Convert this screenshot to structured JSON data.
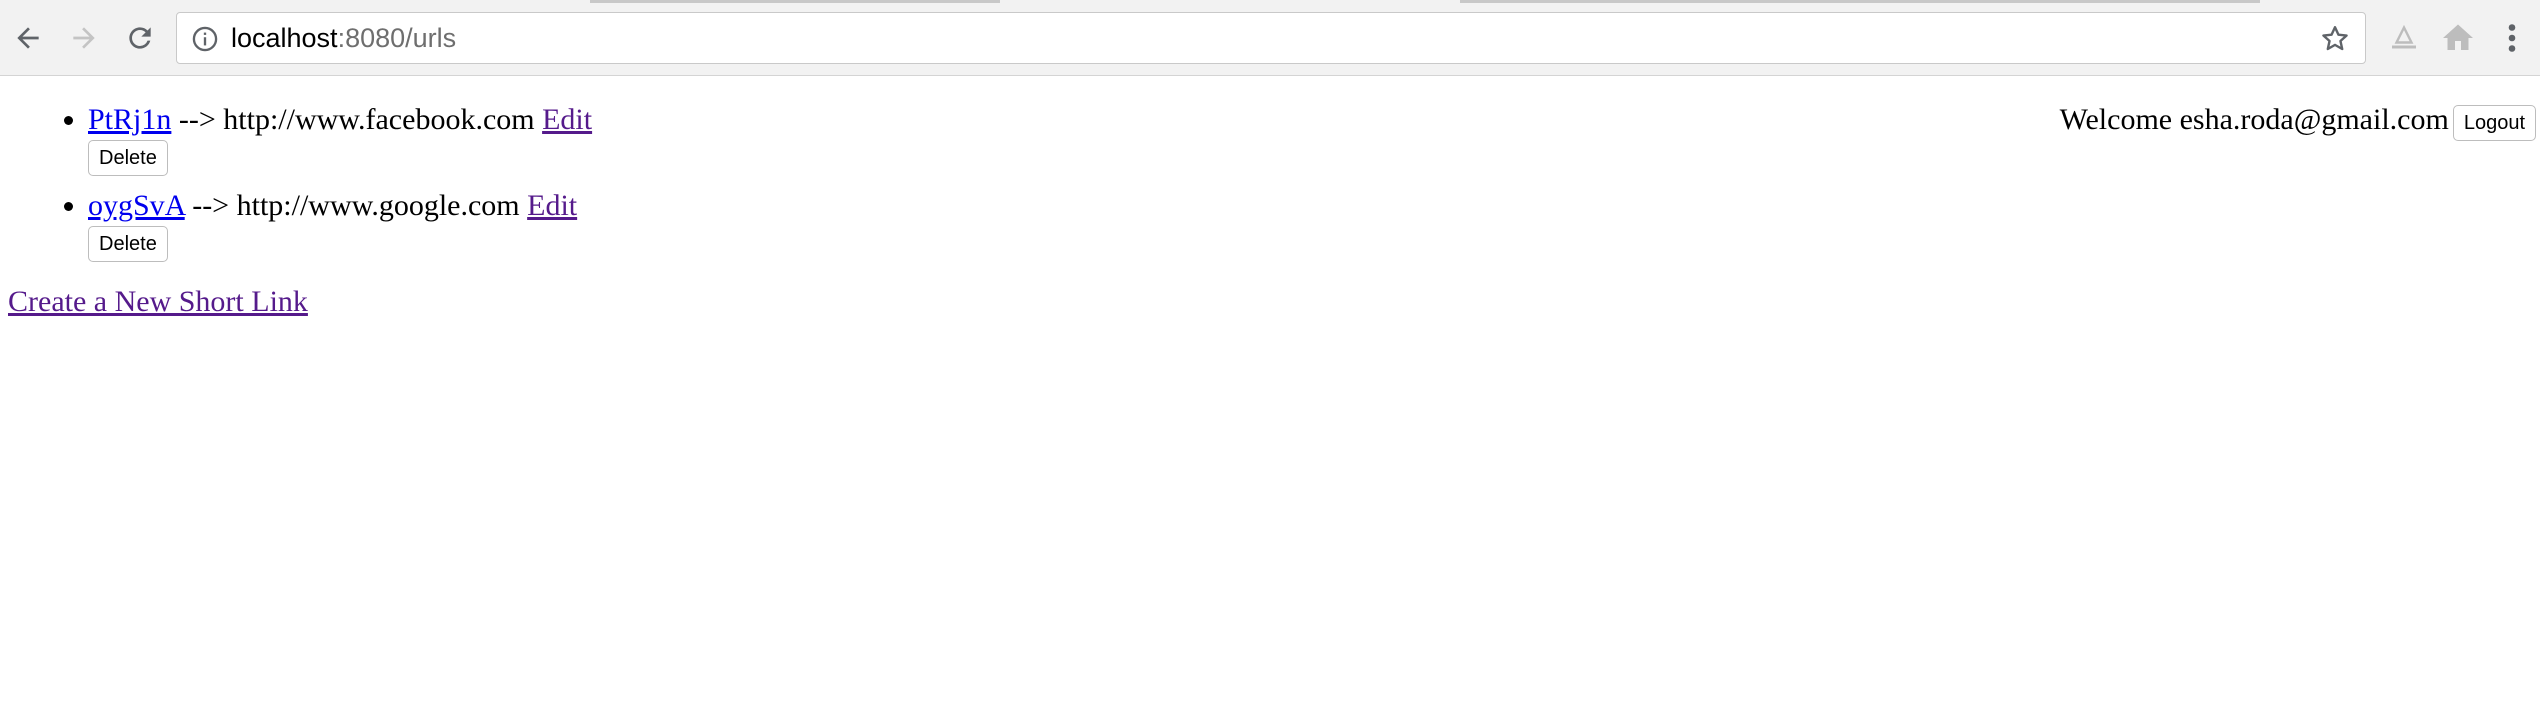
{
  "browser": {
    "url_host": "localhost",
    "url_rest": ":8080/urls"
  },
  "urls": [
    {
      "short": "PtRj1n",
      "separator": " --> ",
      "long": "http://www.facebook.com",
      "edit_label": "Edit",
      "delete_label": "Delete"
    },
    {
      "short": "oygSvA",
      "separator": " --> ",
      "long": "http://www.google.com",
      "edit_label": "Edit",
      "delete_label": "Delete"
    }
  ],
  "header": {
    "welcome_text": "Welcome esha.roda@gmail.com",
    "logout_label": "Logout"
  },
  "create_link_label": "Create a New Short Link"
}
